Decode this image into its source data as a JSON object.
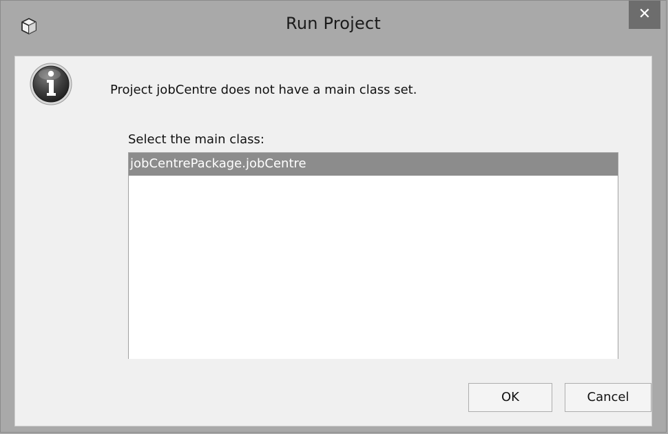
{
  "window": {
    "title": "Run Project",
    "close_glyph": "✕",
    "app_icon": "cube-icon"
  },
  "dialog": {
    "icon": "info-icon",
    "message": "Project jobCentre does not have a main class set.",
    "list_label": "Select the main class:",
    "classes": [
      {
        "label": "jobCentrePackage.jobCentre",
        "selected": true
      }
    ]
  },
  "buttons": {
    "ok_label": "OK",
    "cancel_label": "Cancel"
  },
  "colors": {
    "frame": "#a9a9a9",
    "close_button": "#6d6d6d",
    "selection": "#8c8c8c",
    "client_background": "#f0f0f0"
  }
}
